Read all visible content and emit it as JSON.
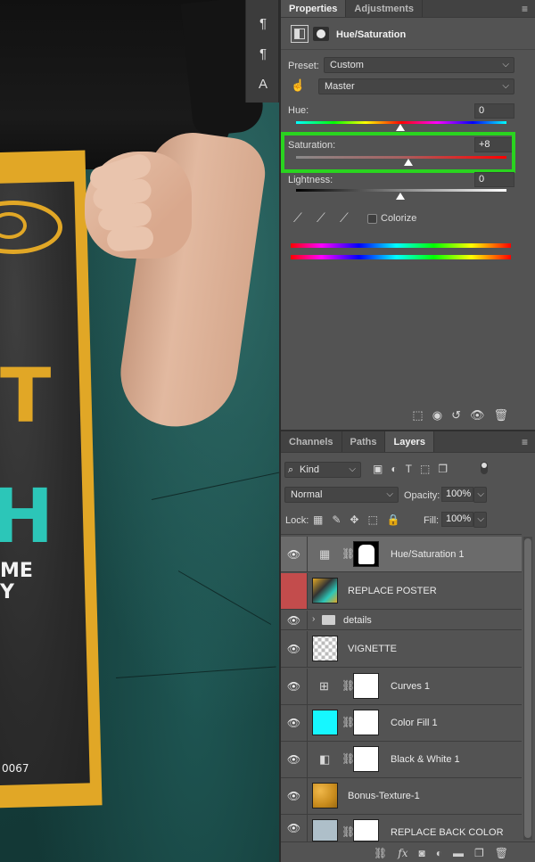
{
  "canvas": {
    "poster_code": "0067",
    "poster_letters": [
      "T",
      "H",
      "ME",
      "Y"
    ]
  },
  "tools_strip": {
    "items": [
      {
        "icon": "paragraph-icon",
        "glyph": "¶"
      },
      {
        "icon": "paragraph-style-icon",
        "glyph": "¶"
      },
      {
        "icon": "character-style-icon",
        "glyph": "A"
      }
    ]
  },
  "properties": {
    "tabs": [
      "Properties",
      "Adjustments"
    ],
    "adjustment_title": "Hue/Saturation",
    "preset_label": "Preset:",
    "preset_value": "Custom",
    "channel_value": "Master",
    "hue": {
      "label": "Hue:",
      "value": "0"
    },
    "saturation": {
      "label": "Saturation:",
      "value": "+8"
    },
    "lightness": {
      "label": "Lightness:",
      "value": "0"
    },
    "colorize_label": "Colorize",
    "colorize_checked": false,
    "highlight_color": "#2ad41f"
  },
  "layers_panel": {
    "tabs": [
      "Channels",
      "Paths",
      "Layers"
    ],
    "filter_kind": "Kind",
    "blend_mode": "Normal",
    "opacity_label": "Opacity:",
    "opacity_value": "100%",
    "lock_label": "Lock:",
    "fill_label": "Fill:",
    "fill_value": "100%",
    "layers": [
      {
        "name": "Hue/Saturation 1",
        "type": "adjustment",
        "selected": true
      },
      {
        "name": "REPLACE POSTER",
        "type": "smart-object",
        "visibility_red": true
      },
      {
        "name": "details",
        "type": "group"
      },
      {
        "name": "VIGNETTE",
        "type": "pixel"
      },
      {
        "name": "Curves 1",
        "type": "adjustment"
      },
      {
        "name": "Color Fill 1",
        "type": "fill"
      },
      {
        "name": "Black & White 1",
        "type": "adjustment"
      },
      {
        "name": "Bonus-Texture-1",
        "type": "pixel"
      },
      {
        "name": "REPLACE BACK COLOR",
        "type": "fill"
      }
    ]
  }
}
